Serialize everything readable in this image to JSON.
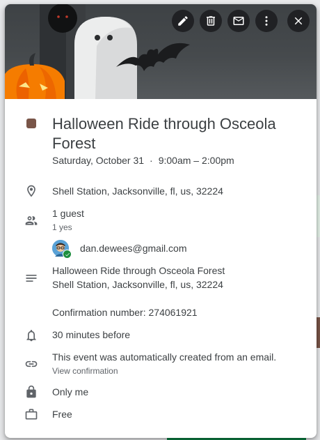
{
  "toolbar": {
    "icons": [
      "edit-icon",
      "delete-icon",
      "email-icon",
      "more-vert-icon",
      "close-icon"
    ]
  },
  "event": {
    "color": "#795548",
    "title": "Halloween Ride through Osceola Forest",
    "date": "Saturday, October 31",
    "separator": "·",
    "time": "9:00am – 2:00pm"
  },
  "location": {
    "icon": "location-pin-icon",
    "text": "Shell Station, Jacksonville, fl, us, 32224"
  },
  "guests": {
    "icon": "people-icon",
    "count_label": "1 guest",
    "summary": "1 yes",
    "list": [
      {
        "email": "dan.dewees@gmail.com",
        "status": "accepted"
      }
    ]
  },
  "description": {
    "icon": "notes-icon",
    "line1": "Halloween Ride through Osceola Forest",
    "line2": "Shell Station, Jacksonville, fl, us, 32224",
    "confirmation": "Confirmation number: 274061921"
  },
  "reminder": {
    "icon": "bell-icon",
    "text": "30 minutes before"
  },
  "source": {
    "icon": "link-icon",
    "text": "This event was automatically created from an email.",
    "link_label": "View confirmation"
  },
  "visibility": {
    "icon": "lock-icon",
    "text": "Only me"
  },
  "availability": {
    "icon": "briefcase-icon",
    "text": "Free"
  },
  "colors": {
    "accent": "#795548",
    "toolbar_button": "#202124",
    "guest_accepted": "#1e8e3e"
  }
}
